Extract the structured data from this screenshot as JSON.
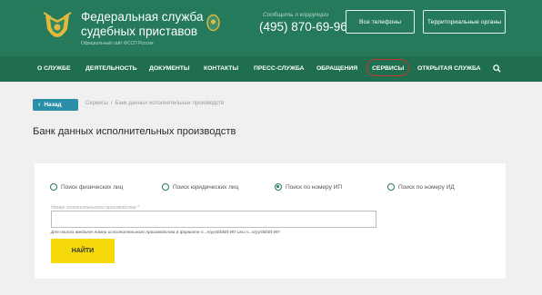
{
  "header": {
    "title_line1": "Федеральная служба",
    "title_line2": "судебных приставов",
    "subtitle": "Официальный сайт ФССП России",
    "hotline_caption": "Сообщить о коррупции",
    "phone": "(495) 870-69-96",
    "all_phones_label": "Все телефоны",
    "territorial_label": "Территориальные органы",
    "brand_color": "#247a5a"
  },
  "nav": {
    "items": [
      "О СЛУЖБЕ",
      "ДЕЯТЕЛЬНОСТЬ",
      "ДОКУМЕНТЫ",
      "КОНТАКТЫ",
      "ПРЕСС-СЛУЖБА",
      "ОБРАЩЕНИЯ",
      "СЕРВИСЫ",
      "ОТКРЫТАЯ СЛУЖБА"
    ],
    "active": "СЕРВИСЫ",
    "search_icon": "search-icon"
  },
  "back_button": {
    "label": "Назад"
  },
  "breadcrumb": [
    "Сервисы",
    "Банк данных исполнительных производств"
  ],
  "page_title": "Банк данных исполнительных производств",
  "search_form": {
    "options": [
      "Поиск физических лиц",
      "Поиск юридических лиц",
      "Поиск по номеру ИП",
      "Поиск по номеру ИД"
    ],
    "selected": "Поиск по номеру ИП",
    "field_label": "Номер исполнительного производства *",
    "field_value": "",
    "hint": "Для поиска введите номер исполнительного производства в формате n...n/yy/ddddd-ИП или n...n/yy/dd/dd-ИП",
    "submit_label": "НАЙТИ",
    "submit_color": "#f5d90a"
  }
}
